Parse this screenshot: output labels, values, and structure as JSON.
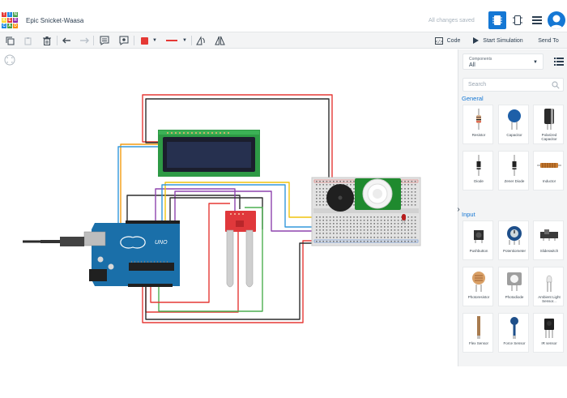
{
  "app": {
    "logo_letters": [
      "T",
      "I",
      "N",
      "K",
      "E",
      "R",
      "C",
      "A",
      "D"
    ],
    "logo_colors": [
      "#e53935",
      "#1e88e5",
      "#43a047",
      "#fdd835",
      "#e53935",
      "#8e24aa",
      "#1e88e5",
      "#43a047",
      "#fb8c00"
    ],
    "doc_title": "Epic Snicket-Waasa",
    "save_status": "All changes saved",
    "accent": "#1477d4"
  },
  "toolbar": {
    "code_label": "Code",
    "start_simulation_label": "Start Simulation",
    "send_to_label": "Send To",
    "wire_color": "#e53935"
  },
  "panel": {
    "components_label": "Components",
    "components_value": "All",
    "search_placeholder": "Search",
    "sections": [
      {
        "title": "General",
        "items": [
          {
            "name": "Resistor",
            "icon": "resistor-icon"
          },
          {
            "name": "Capacitor",
            "icon": "capacitor-icon"
          },
          {
            "name": "Polarized Capacitor",
            "icon": "polarized-capacitor-icon"
          },
          {
            "name": "Diode",
            "icon": "diode-icon"
          },
          {
            "name": "Zener Diode",
            "icon": "zener-diode-icon"
          },
          {
            "name": "Inductor",
            "icon": "inductor-icon"
          }
        ]
      },
      {
        "title": "Input",
        "items": [
          {
            "name": "Pushbutton",
            "icon": "pushbutton-icon"
          },
          {
            "name": "Potentiometer",
            "icon": "potentiometer-icon"
          },
          {
            "name": "Slideswitch",
            "icon": "slideswitch-icon"
          },
          {
            "name": "Photoresistor",
            "icon": "photoresistor-icon"
          },
          {
            "name": "Photodiode",
            "icon": "photodiode-icon"
          },
          {
            "name": "Ambient Light Sensor...",
            "icon": "ambient-light-sensor-icon"
          },
          {
            "name": "Flex Sensor",
            "icon": "flex-sensor-icon"
          },
          {
            "name": "Force Sensor",
            "icon": "force-sensor-icon"
          },
          {
            "name": "IR sensor",
            "icon": "ir-sensor-icon"
          }
        ]
      }
    ]
  },
  "circuit": {
    "board_label": "UNO"
  }
}
